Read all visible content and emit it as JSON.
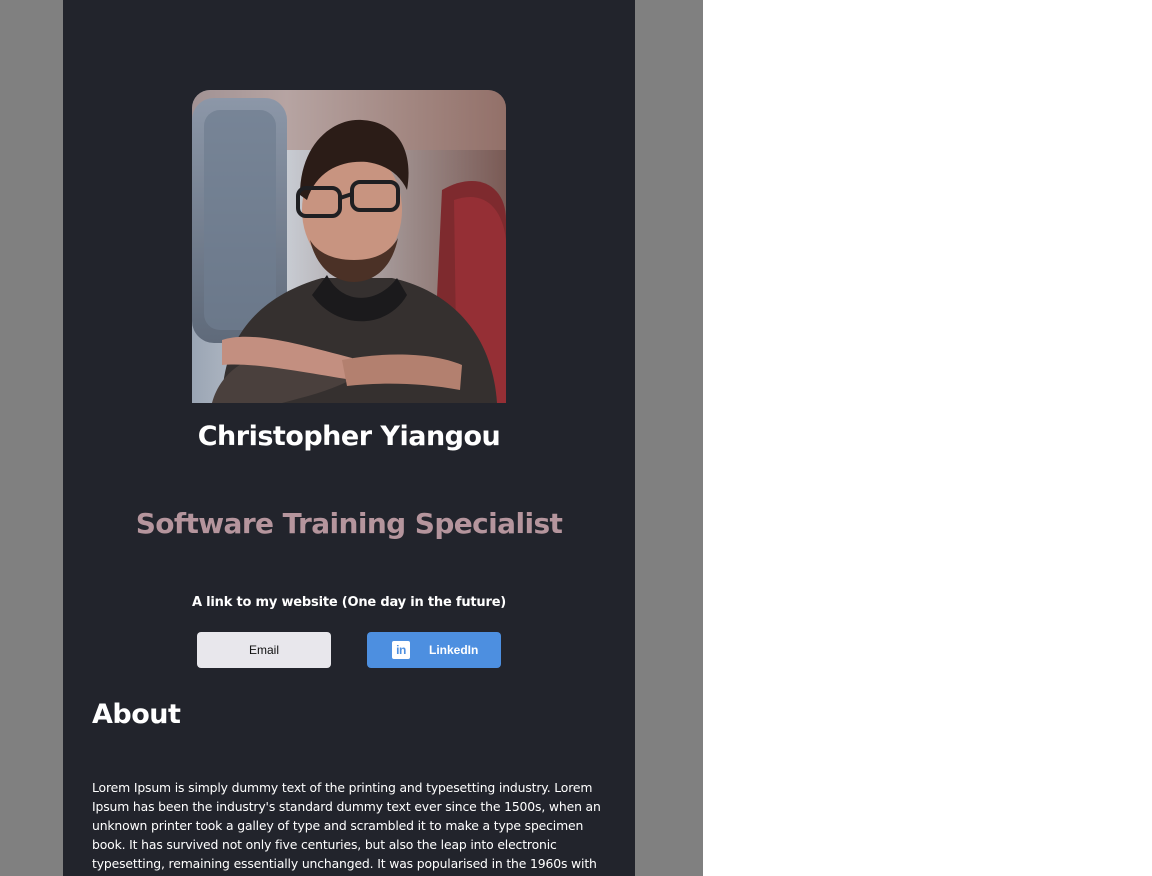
{
  "profile": {
    "name": "Christopher Yiangou",
    "job_title": "Software Training Specialist",
    "website_link": "A link to my website (One day in the future)"
  },
  "buttons": {
    "email_label": "Email",
    "linkedin_label": "LinkedIn",
    "linkedin_icon_text": "in"
  },
  "about": {
    "heading": "About",
    "text": "Lorem Ipsum is simply dummy text of the printing and typesetting industry. Lorem Ipsum has been the industry's standard dummy text ever since the 1500s, when an unknown printer took a galley of type and scrambled it to make a type specimen book. It has survived not only five centuries, but also the leap into electronic typesetting, remaining essentially unchanged. It was popularised in the 1960s with"
  },
  "colors": {
    "card_background": "#22242c",
    "page_backdrop": "#808080",
    "job_title": "#b5959d",
    "email_button": "#e8e7ec",
    "linkedin_button": "#4d8fe0"
  },
  "icons": {
    "linkedin": "linkedin-icon"
  }
}
